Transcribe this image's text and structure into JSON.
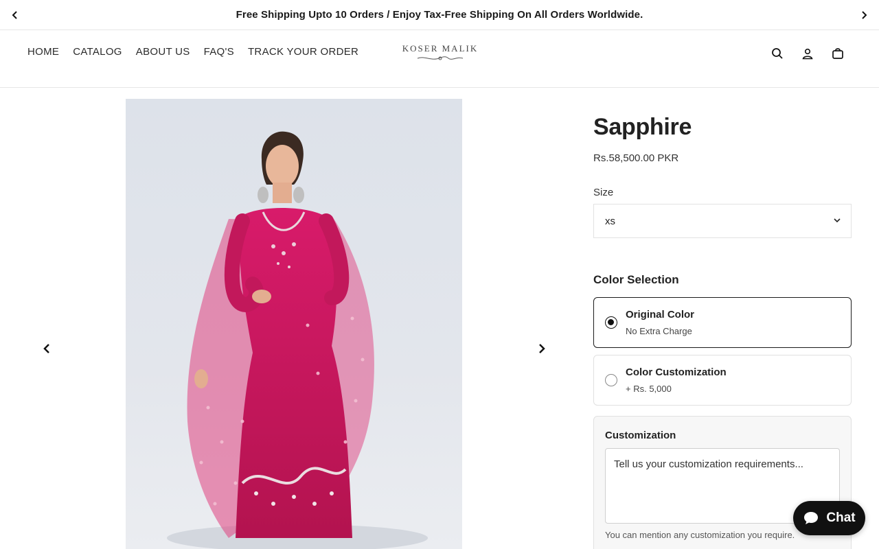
{
  "announcement": {
    "text": "Free Shipping Upto 10 Orders / Enjoy Tax-Free Shipping On All Orders Worldwide."
  },
  "nav": {
    "items": [
      {
        "label": "HOME"
      },
      {
        "label": "CATALOG"
      },
      {
        "label": "ABOUT US"
      },
      {
        "label": "FAQ'S"
      },
      {
        "label": "TRACK YOUR ORDER"
      }
    ]
  },
  "brand": {
    "logo_text": "KOSER MALIK"
  },
  "header_icons": [
    "search-icon",
    "account-icon",
    "cart-icon"
  ],
  "product": {
    "title": "Sapphire",
    "price": "Rs.58,500.00 PKR",
    "size_label": "Size",
    "size_value": "xs",
    "color_section_label": "Color Selection",
    "color_options": [
      {
        "title": "Original Color",
        "subtitle": "No Extra Charge",
        "selected": true
      },
      {
        "title": "Color Customization",
        "subtitle": "+ Rs. 5,000",
        "selected": false
      }
    ],
    "customization": {
      "label": "Customization",
      "placeholder": "Tell us your customization requirements...",
      "help": "You can mention any customization you require."
    }
  },
  "chat": {
    "label": "Chat"
  },
  "colors": {
    "dress": "#c2185b",
    "photo_bg": "#dfe3ea",
    "chat_bg": "#111111"
  }
}
